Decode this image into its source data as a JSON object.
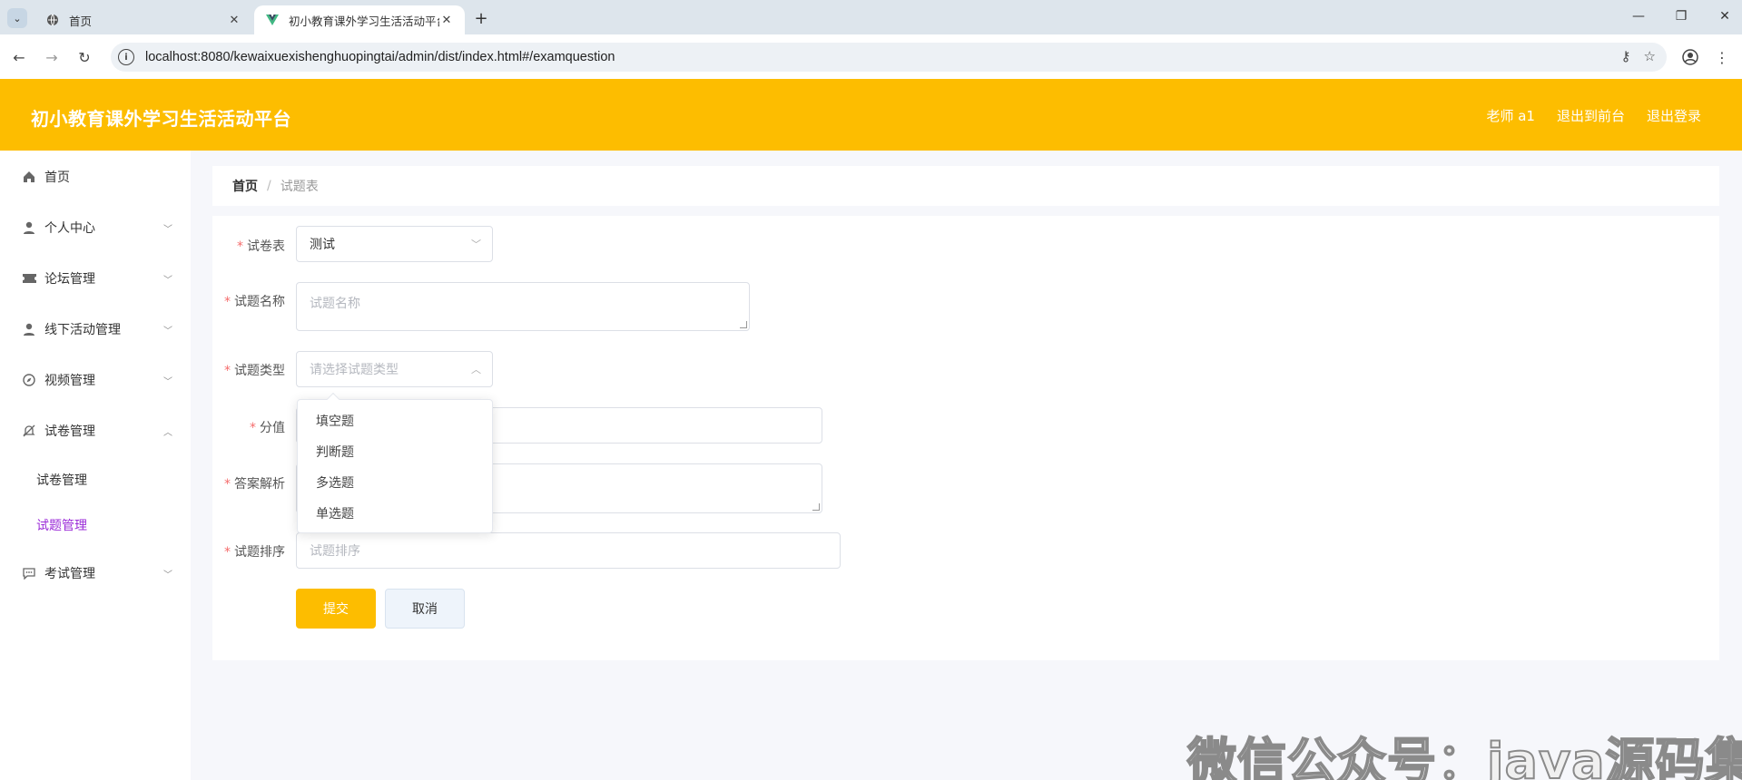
{
  "browser": {
    "tabs": [
      {
        "title": "首页"
      },
      {
        "title": "初小教育课外学习生活活动平台"
      }
    ],
    "url": "localhost:8080/kewaixuexishenghuopingtai/admin/dist/index.html#/examquestion"
  },
  "header": {
    "title": "初小教育课外学习生活活动平台",
    "user": "老师 a1",
    "to_front": "退出到前台",
    "logout": "退出登录"
  },
  "sidebar": {
    "items": [
      {
        "label": "首页"
      },
      {
        "label": "个人中心"
      },
      {
        "label": "论坛管理"
      },
      {
        "label": "线下活动管理"
      },
      {
        "label": "视频管理"
      },
      {
        "label": "试卷管理"
      },
      {
        "label": "考试管理"
      }
    ],
    "sub_items": [
      {
        "label": "试卷管理"
      },
      {
        "label": "试题管理"
      }
    ]
  },
  "breadcrumb": {
    "home": "首页",
    "sep": "/",
    "current": "试题表"
  },
  "form": {
    "paper_label": "试卷表",
    "paper_value": "测试",
    "name_label": "试题名称",
    "name_placeholder": "试题名称",
    "type_label": "试题类型",
    "type_placeholder": "请选择试题类型",
    "score_label": "分值",
    "analysis_label": "答案解析",
    "order_label": "试题排序",
    "order_placeholder": "试题排序",
    "submit": "提交",
    "cancel": "取消"
  },
  "dropdown": {
    "options": [
      "填空题",
      "判断题",
      "多选题",
      "单选题"
    ]
  },
  "watermark": "微信公众号：java源码集合",
  "colors": {
    "accent": "#fdbd00",
    "active_submenu": "#9b2bd8",
    "required": "#f56c6c"
  }
}
